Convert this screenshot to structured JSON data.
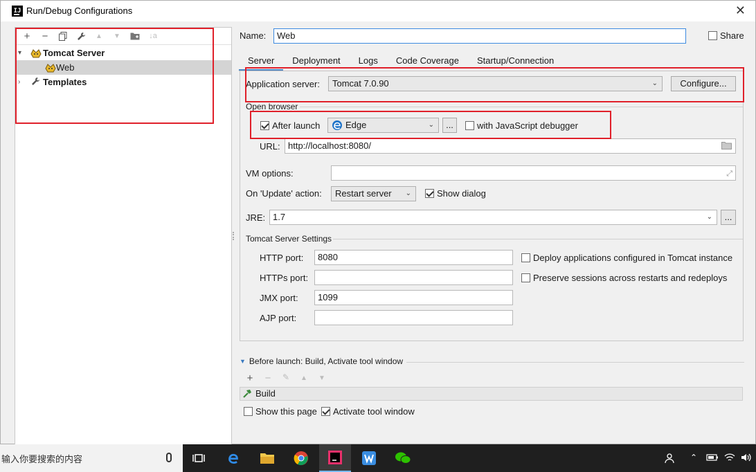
{
  "window": {
    "title": "Run/Debug Configurations",
    "app_icon": "IJ",
    "close": "✕"
  },
  "toolbar": {
    "add": "+",
    "remove": "−",
    "copy": "⎘",
    "edit_defaults": "🔧",
    "move_up": "▲",
    "move_down": "▼",
    "folder": "📁",
    "sort": "↓a"
  },
  "tree": {
    "tomcat_server": "Tomcat Server",
    "web": "Web",
    "templates": "Templates"
  },
  "name": {
    "label": "Name:",
    "value": "Web"
  },
  "share": {
    "label": "Share",
    "checked": false
  },
  "tabs": [
    "Server",
    "Deployment",
    "Logs",
    "Code Coverage",
    "Startup/Connection"
  ],
  "server": {
    "app_server_label": "Application server:",
    "app_server_value": "Tomcat 7.0.90",
    "configure_button": "Configure...",
    "open_browser_label": "Open browser",
    "after_launch_label": "After launch",
    "after_launch_checked": true,
    "browser_value": "Edge",
    "browse_button": "...",
    "js_debugger_label": "with JavaScript debugger",
    "url_label": "URL:",
    "url_value": "http://localhost:8080/",
    "vm_options_label": "VM options:",
    "vm_options_value": "",
    "update_action_label": "On 'Update' action:",
    "update_action_value": "Restart server",
    "show_dialog_label": "Show dialog",
    "show_dialog_checked": true,
    "jre_label": "JRE:",
    "jre_value": "1.7",
    "jre_button": "...",
    "tomcat_settings_label": "Tomcat Server Settings",
    "http_port_label": "HTTP port:",
    "http_port_value": "8080",
    "https_port_label": "HTTPs port:",
    "https_port_value": "",
    "jmx_port_label": "JMX port:",
    "jmx_port_value": "1099",
    "ajp_port_label": "AJP port:",
    "ajp_port_value": "",
    "deploy_apps_label": "Deploy applications configured in Tomcat instance",
    "preserve_sessions_label": "Preserve sessions across restarts and redeploys"
  },
  "before_launch": {
    "label": "Before launch: Build, Activate tool window",
    "build_item": "Build",
    "show_page_label": "Show this page",
    "activate_tool_label": "Activate tool window"
  },
  "taskbar": {
    "search_placeholder": "输入你要搜索的内容"
  },
  "colors": {
    "annotation": "#e0202a",
    "accent": "#4a88c7",
    "focus": "#3c8ae0"
  }
}
